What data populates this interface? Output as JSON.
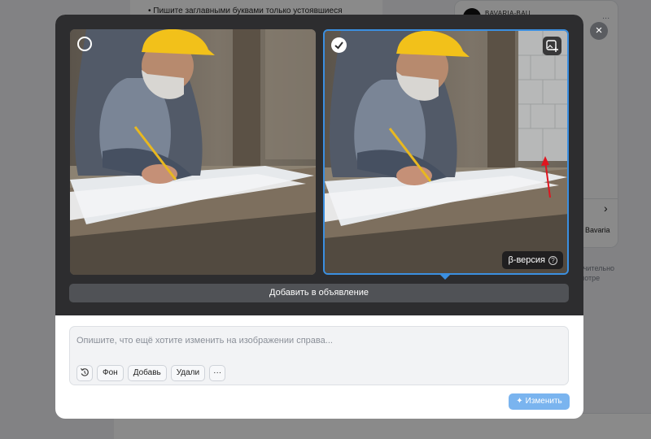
{
  "background": {
    "post_bullet": "• Пишите заглавными буквами только устоявшиеся",
    "brand_name": "BAVARIA-BAU",
    "menu_dots": "...",
    "chevron": "›",
    "card_text": "с Bavaria",
    "card_text_2": "ечительно",
    "card_text_3": "мотре"
  },
  "modal": {
    "close_label": "×",
    "beta_label": "β-версия",
    "help_symbol": "?",
    "add_button_label": "Добавить в объявление",
    "prompt_placeholder": "Опишите, что ещё хотите изменить на изображении справа...",
    "prompt_value": "",
    "chips": [
      {
        "label": "Фон"
      },
      {
        "label": "Добавь"
      },
      {
        "label": "Удали"
      }
    ],
    "more_label": "···",
    "submit_label": "Изменить",
    "submit_icon": "✦"
  },
  "icons": {
    "undo": "undo-icon",
    "image_add": "image-add-icon",
    "check": "check-icon"
  },
  "colors": {
    "accent": "#3b8fe0",
    "submit": "#7ab4ef",
    "modal_dark": "#2d2d2f",
    "arrow": "#e0151f"
  }
}
